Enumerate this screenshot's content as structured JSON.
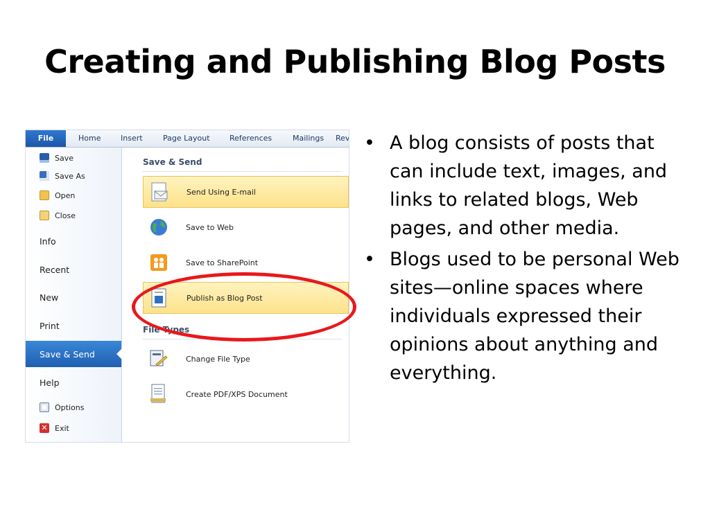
{
  "slide": {
    "title": "Creating and Publishing Blog Posts",
    "bullets": [
      "A blog consists of posts that can include text, images, and links to related blogs, Web pages, and other media.",
      "Blogs used to be personal Web sites—online spaces where individuals expressed their opinions about anything and everything."
    ],
    "bullet_glyph": "•",
    "highlight_color": "#e8181c"
  },
  "screenshot": {
    "tabs": [
      "File",
      "Home",
      "Insert",
      "Page Layout",
      "References",
      "Mailings",
      "Rev"
    ],
    "left_menu": {
      "small_top": [
        {
          "label": "Save",
          "icon": "save-icon"
        },
        {
          "label": "Save As",
          "icon": "save-as-icon"
        },
        {
          "label": "Open",
          "icon": "open-folder-icon"
        },
        {
          "label": "Close",
          "icon": "close-folder-icon"
        }
      ],
      "big": [
        "Info",
        "Recent",
        "New",
        "Print",
        "Save & Send",
        "Help"
      ],
      "active": "Save & Send",
      "small_bottom": [
        {
          "label": "Options",
          "icon": "options-icon"
        },
        {
          "label": "Exit",
          "icon": "exit-icon"
        }
      ]
    },
    "save_send": {
      "heading": "Save & Send",
      "options": [
        {
          "label": "Send Using E-mail",
          "icon": "email-icon"
        },
        {
          "label": "Save to Web",
          "icon": "globe-icon"
        },
        {
          "label": "Save to SharePoint",
          "icon": "sharepoint-icon"
        },
        {
          "label": "Publish as Blog Post",
          "icon": "blog-post-icon"
        }
      ],
      "file_types_heading": "File Types",
      "file_type_options": [
        {
          "label": "Change File Type",
          "icon": "change-file-type-icon"
        },
        {
          "label": "Create PDF/XPS Document",
          "icon": "pdf-document-icon"
        }
      ]
    }
  }
}
